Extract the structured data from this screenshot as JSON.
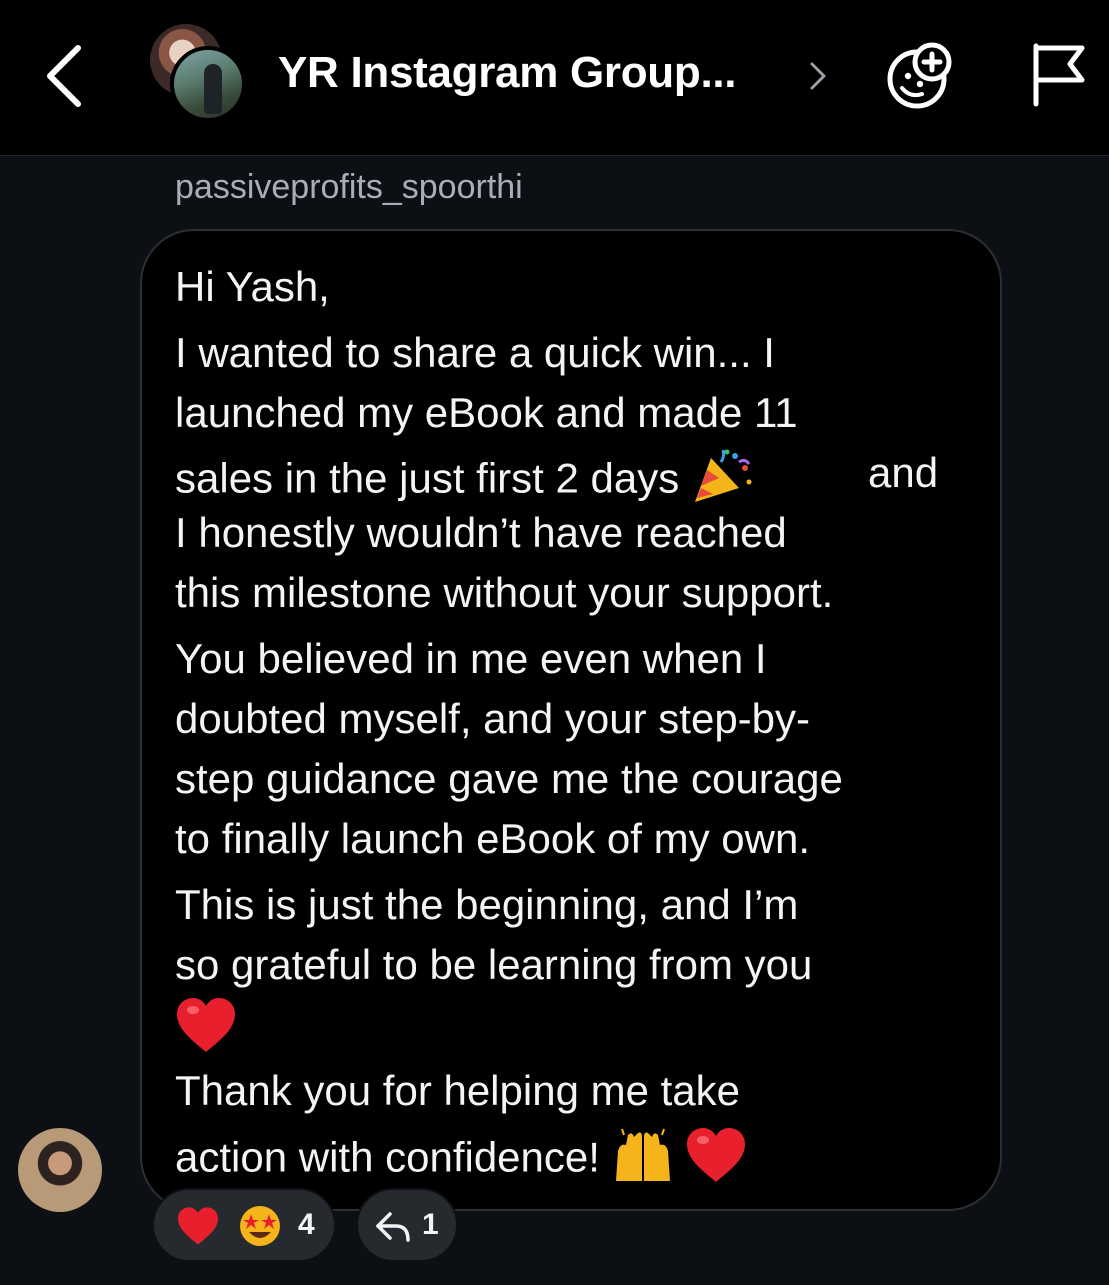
{
  "header": {
    "title": "YR Instagram Group...",
    "icons": [
      "chevron-left-icon",
      "group-avatar",
      "chevron-right-icon",
      "sticker-add-icon",
      "flag-icon"
    ]
  },
  "message": {
    "sender": "passiveprofits_spoorthi",
    "lines": [
      "Hi Yash,",
      "I wanted to share a quick win... I",
      "launched my eBook and made 11",
      "sales in the just first 2 days",
      "and",
      "I honestly wouldn’t have reached",
      "this milestone without your support.",
      "You believed in me even when I",
      "doubted myself, and your step-by-",
      "step guidance gave me the courage",
      "to finally launch eBook of my own.",
      "This is just the beginning, and I’m",
      "so grateful to be learning from you",
      "Thank you for helping me take",
      "action with confidence!"
    ],
    "emojis": [
      "party-popper-icon",
      "heart-icon",
      "raised-hands-icon",
      "heart-icon"
    ]
  },
  "reactions": {
    "count": "4",
    "icons": [
      "heart-icon",
      "star-struck-icon"
    ]
  },
  "replies": {
    "count": "1",
    "icon": "reply-arrow-icon"
  },
  "colors": {
    "background": "#0c1014",
    "topbar": "#000000",
    "bubble": "#000000",
    "pill": "#262a2f",
    "sender_text": "#a8aeb5",
    "heart": "#e8202e"
  }
}
